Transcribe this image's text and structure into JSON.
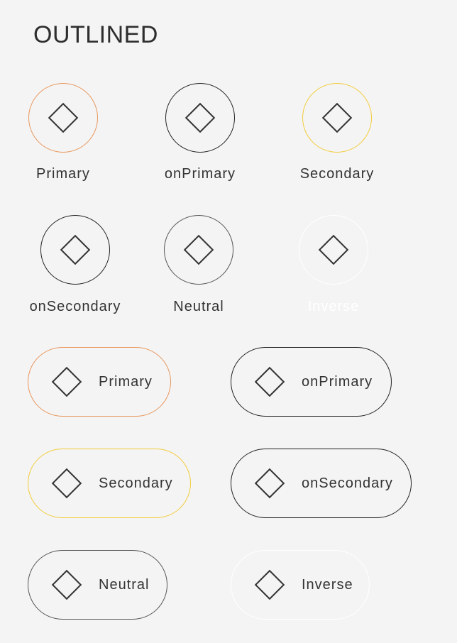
{
  "header": {
    "title": "OUTLINED"
  },
  "colors": {
    "primary": "#e8975e",
    "on_primary": "#222222",
    "secondary": "#f2cc3c",
    "on_secondary": "#222222",
    "neutral": "#555555",
    "inverse": "#ffffff",
    "text": "#333333",
    "diamond": "#333333"
  },
  "icon_buttons": [
    {
      "label": "Primary",
      "color_key": "primary",
      "icon": "diamond-icon"
    },
    {
      "label": "onPrimary",
      "color_key": "on_primary",
      "icon": "diamond-icon"
    },
    {
      "label": "Secondary",
      "color_key": "secondary",
      "icon": "diamond-icon"
    },
    {
      "label": "onSecondary",
      "color_key": "on_secondary",
      "icon": "diamond-icon"
    },
    {
      "label": "Neutral",
      "color_key": "neutral",
      "icon": "diamond-icon"
    },
    {
      "label": "Inverse",
      "color_key": "inverse",
      "icon": "diamond-icon"
    }
  ],
  "pill_buttons": [
    {
      "label": "Primary",
      "color_key": "primary",
      "icon": "diamond-icon"
    },
    {
      "label": "onPrimary",
      "color_key": "on_primary",
      "icon": "diamond-icon"
    },
    {
      "label": "Secondary",
      "color_key": "secondary",
      "icon": "diamond-icon"
    },
    {
      "label": "onSecondary",
      "color_key": "on_secondary",
      "icon": "diamond-icon"
    },
    {
      "label": "Neutral",
      "color_key": "neutral",
      "icon": "diamond-icon"
    },
    {
      "label": "Inverse",
      "color_key": "inverse",
      "icon": "diamond-icon"
    }
  ]
}
